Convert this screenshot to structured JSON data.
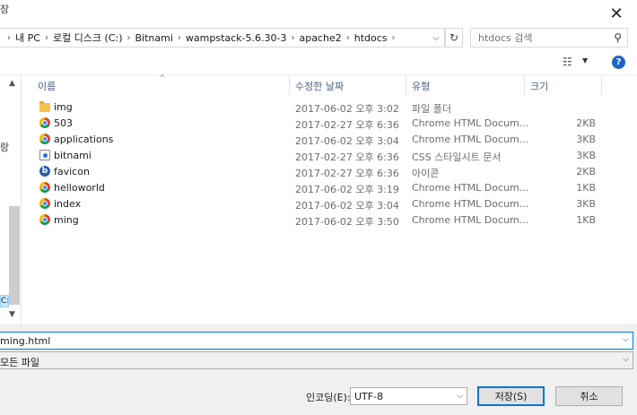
{
  "titlebar": {
    "title_fragment": "장",
    "close_glyph": "✕"
  },
  "address": {
    "crumbs": [
      "내 PC",
      "로컬 디스크 (C:)",
      "Bitnami",
      "wampstack-5.6.30-3",
      "apache2",
      "htdocs"
    ],
    "search_placeholder": "htdocs 검색"
  },
  "navpane": {
    "fragment1": "랑",
    "fragment2": "C:)"
  },
  "columns": {
    "name": "이름",
    "date": "수정한 날짜",
    "type": "유형",
    "size": "크기"
  },
  "files": [
    {
      "name": "img",
      "date": "2017-06-02 오후 3:02",
      "type": "파일 폴더",
      "size": "",
      "icon": "folder-icon"
    },
    {
      "name": "503",
      "date": "2017-02-27 오후 6:36",
      "type": "Chrome HTML Docum...",
      "size": "2KB",
      "icon": "chrome-icon"
    },
    {
      "name": "applications",
      "date": "2017-06-02 오후 3:04",
      "type": "Chrome HTML Docum...",
      "size": "3KB",
      "icon": "chrome-icon"
    },
    {
      "name": "bitnami",
      "date": "2017-02-27 오후 6:36",
      "type": "CSS 스타일시트 문서",
      "size": "3KB",
      "icon": "css-icon"
    },
    {
      "name": "favicon",
      "date": "2017-02-27 오후 6:36",
      "type": "아이콘",
      "size": "2KB",
      "icon": "favicon-icon"
    },
    {
      "name": "helloworld",
      "date": "2017-06-02 오후 3:19",
      "type": "Chrome HTML Docum...",
      "size": "1KB",
      "icon": "chrome-icon"
    },
    {
      "name": "index",
      "date": "2017-06-02 오후 3:04",
      "type": "Chrome HTML Docum...",
      "size": "3KB",
      "icon": "chrome-icon"
    },
    {
      "name": "ming",
      "date": "2017-06-02 오후 3:50",
      "type": "Chrome HTML Docum...",
      "size": "1KB",
      "icon": "chrome-icon"
    }
  ],
  "bottom": {
    "filename_value": "ming.html",
    "filetype_value": "모든 파일",
    "encoding_label": "인코딩(E):",
    "encoding_value": "UTF-8",
    "save_label": "저장(S)",
    "cancel_label": "취소"
  }
}
